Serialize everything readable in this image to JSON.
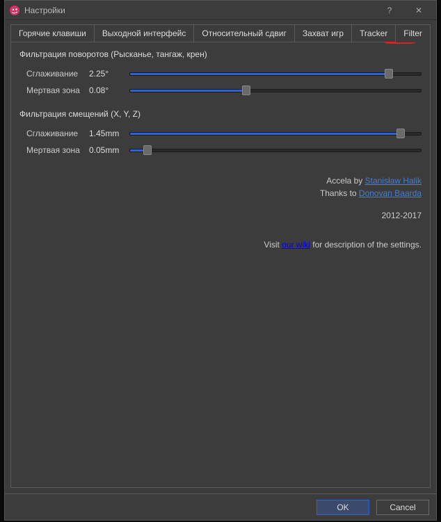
{
  "window": {
    "title": "Настройки",
    "help": "?",
    "close": "✕"
  },
  "tabs": [
    {
      "label": "Горячие клавиши",
      "active": false
    },
    {
      "label": "Выходной интерфейс",
      "active": false
    },
    {
      "label": "Относительный сдвиг",
      "active": false
    },
    {
      "label": "Захват игр",
      "active": false
    },
    {
      "label": "Tracker",
      "active": false
    },
    {
      "label": "Filter",
      "active": true
    }
  ],
  "filter": {
    "rot_group": "Фильтрация поворотов (Рысканье, тангаж, крен)",
    "pos_group": "Фильтрация смещений (X, Y, Z)",
    "smoothing_label": "Сглаживание",
    "deadzone_label": "Мертвая зона",
    "rot_smoothing": {
      "value": "2.25°",
      "pct": 89
    },
    "rot_deadzone": {
      "value": "0.08°",
      "pct": 40
    },
    "pos_smoothing": {
      "value": "1.45mm",
      "pct": 93
    },
    "pos_deadzone": {
      "value": "0.05mm",
      "pct": 6
    }
  },
  "credits": {
    "accela_by": "Accela by ",
    "author1": "Stanisław Halik",
    "thanks_to": "Thanks to ",
    "author2": "Donovan Baarda",
    "years": "2012-2017",
    "visit": "Visit ",
    "wiki": "our wiki",
    "wiki_rest": " for description of the settings."
  },
  "footer": {
    "ok": "OK",
    "cancel": "Cancel"
  }
}
